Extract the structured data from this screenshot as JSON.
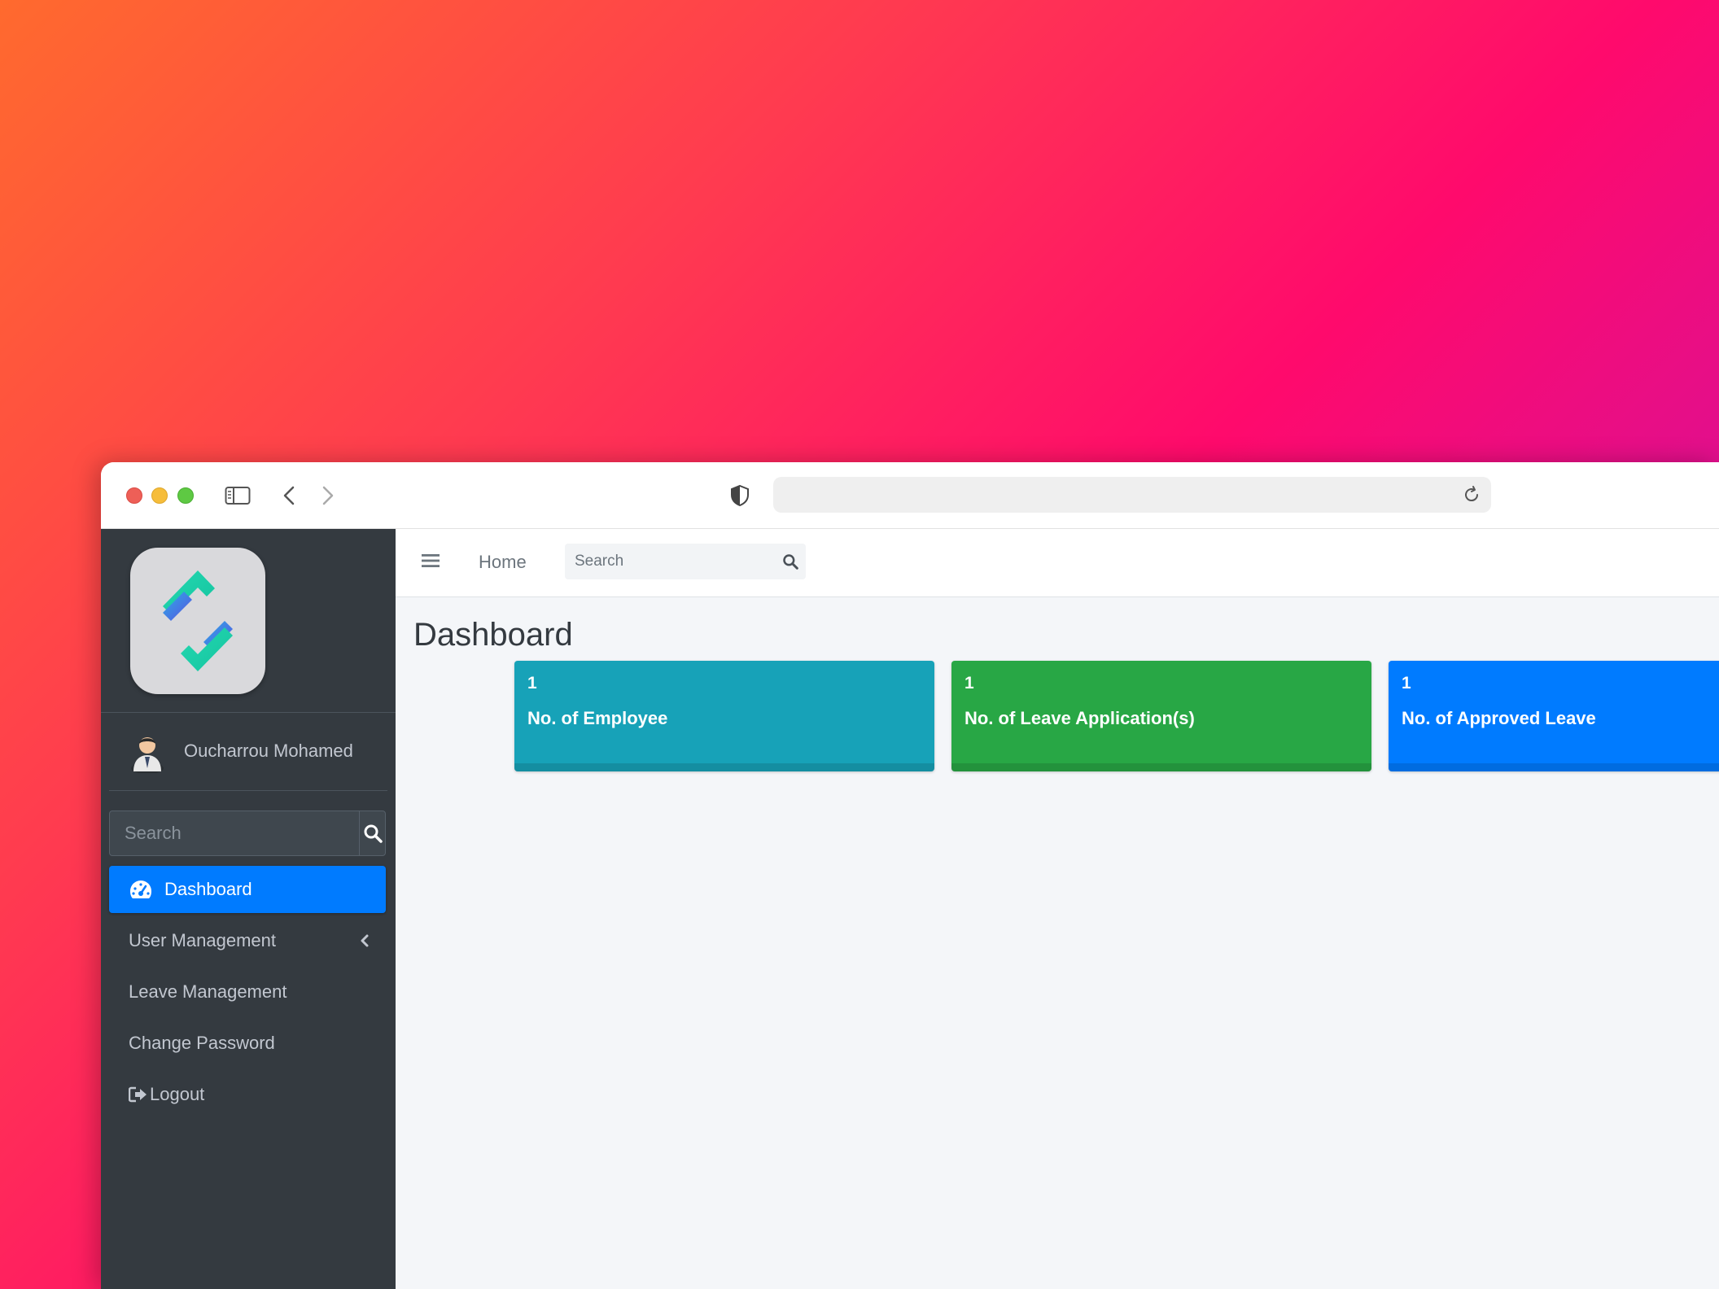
{
  "sidebar": {
    "user_name": "Oucharrou Mohamed",
    "search_placeholder": "Search",
    "items": [
      {
        "label": "Dashboard",
        "active": true,
        "icon": "tachometer-icon"
      },
      {
        "label": "User Management",
        "icon": "chevron-left-icon"
      },
      {
        "label": "Leave Management"
      },
      {
        "label": "Change Password"
      },
      {
        "label": "Logout",
        "icon": "sign-out-icon"
      }
    ]
  },
  "topnav": {
    "home_label": "Home",
    "search_placeholder": "Search"
  },
  "main": {
    "title": "Dashboard",
    "cards": [
      {
        "count": "1",
        "label": "No. of Employee",
        "color": "#17a2b8"
      },
      {
        "count": "1",
        "label": "No. of Leave Application(s)",
        "color": "#28a745"
      },
      {
        "count": "1",
        "label": "No. of Approved Leave",
        "color": "#007bff"
      }
    ]
  },
  "colors": {
    "sidebar_bg": "#343a40",
    "accent": "#007bff",
    "content_bg": "#f4f6f9"
  }
}
